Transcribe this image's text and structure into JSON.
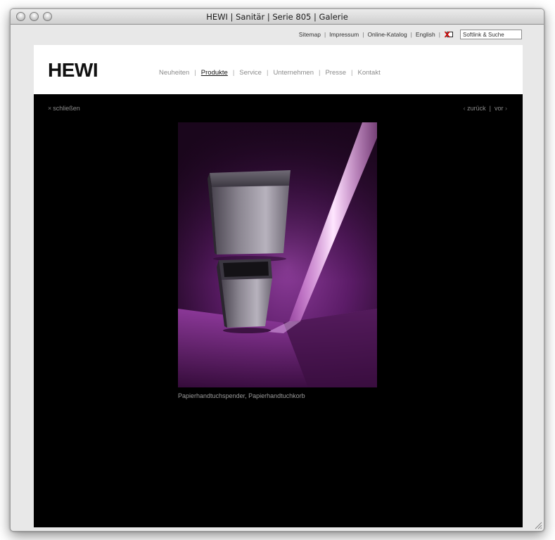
{
  "window": {
    "title": "HEWI | Sanitär | Serie 805 | Galerie"
  },
  "utility_nav": {
    "items": [
      "Sitemap",
      "Impressum",
      "Online-Katalog",
      "English"
    ],
    "separator": "|",
    "softlink_icon": "softlink-icon",
    "search_value": "Softlink & Suche"
  },
  "header": {
    "logo": "HEWI",
    "nav": [
      {
        "label": "Neuheiten",
        "active": false
      },
      {
        "label": "Produkte",
        "active": true
      },
      {
        "label": "Service",
        "active": false
      },
      {
        "label": "Unternehmen",
        "active": false
      },
      {
        "label": "Presse",
        "active": false
      },
      {
        "label": "Kontakt",
        "active": false
      }
    ],
    "separator": "|"
  },
  "gallery": {
    "close_symbol": "×",
    "close_label": "schließen",
    "prev_label": "zurück",
    "next_label": "vor",
    "prev_arrow": "‹",
    "next_arrow": "›",
    "pager_separator": "|",
    "caption": "Papierhandtuchspender, Papierhandtuchkorb"
  },
  "colors": {
    "stage_background": "#000000",
    "photo_accent": "#7a2a86",
    "active_nav": "#111111",
    "inactive_nav": "#8a8a8a"
  }
}
